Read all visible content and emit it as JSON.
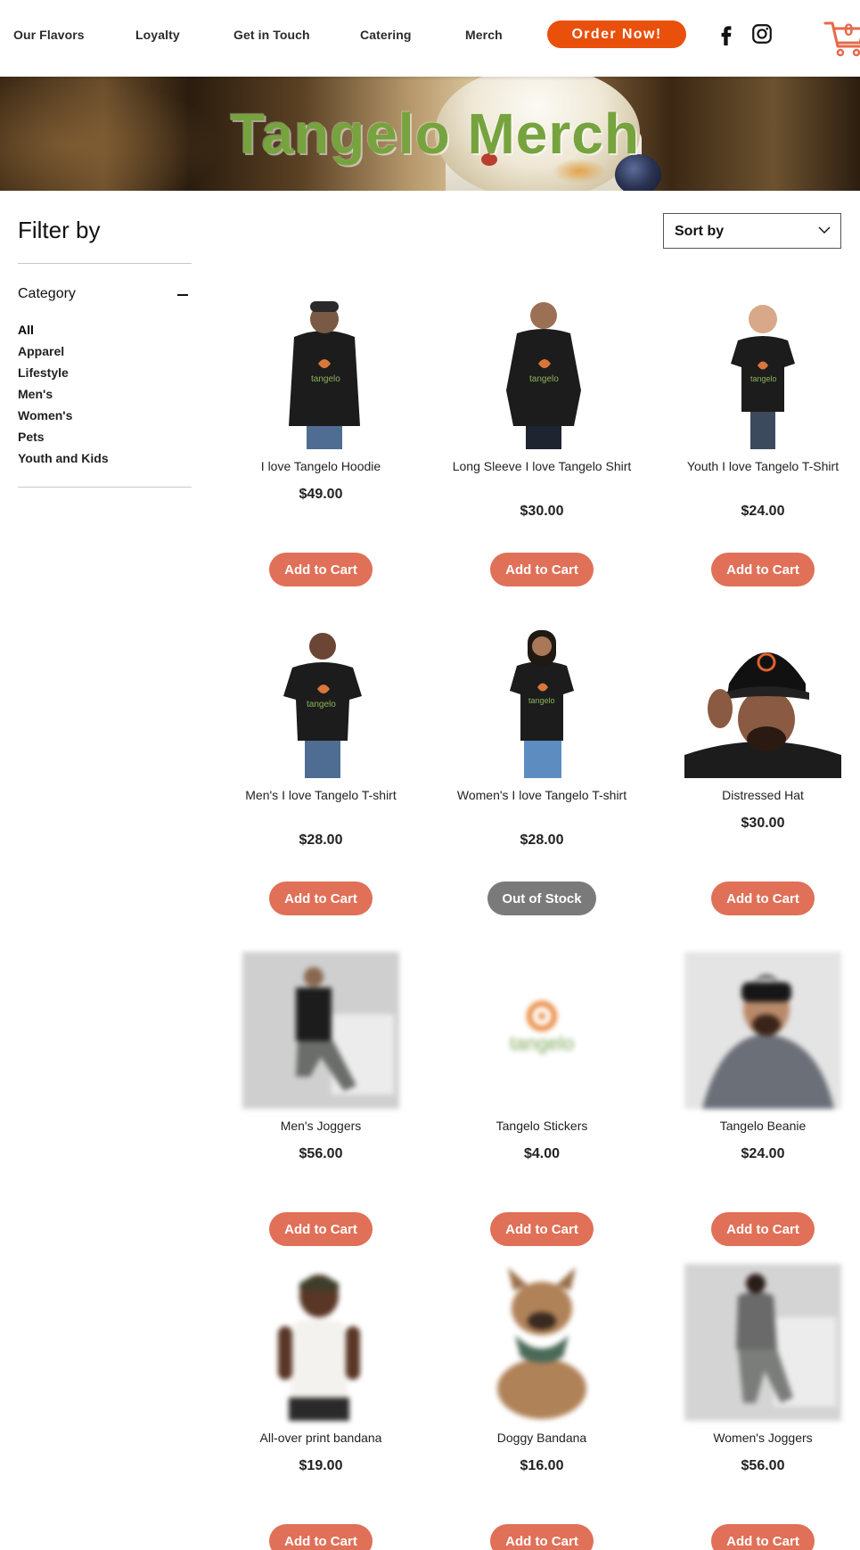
{
  "header": {
    "nav": [
      {
        "label": "Our Flavors"
      },
      {
        "label": "Loyalty"
      },
      {
        "label": "Get in Touch"
      },
      {
        "label": "Catering"
      },
      {
        "label": "Merch"
      }
    ],
    "order_button": "Order Now!",
    "social": [
      "facebook-icon",
      "instagram-icon"
    ],
    "cart_count": "0"
  },
  "banner": {
    "title": "Tangelo Merch"
  },
  "filter": {
    "title": "Filter by",
    "category_title": "Category",
    "categories": [
      "All",
      "Apparel",
      "Lifestyle",
      "Men's",
      "Women's",
      "Pets",
      "Youth and Kids"
    ]
  },
  "sort": {
    "label": "Sort by"
  },
  "colors": {
    "accent": "#e8500c",
    "button": "#e07058",
    "title_green": "#76a33e",
    "out_of_stock": "#7a7a7a"
  },
  "products": [
    {
      "name": "I love Tangelo Hoodie",
      "price": "$49.00",
      "button": "Add to Cart"
    },
    {
      "name": "Long Sleeve I love Tangelo Shirt",
      "price": "$30.00",
      "button": "Add to Cart"
    },
    {
      "name": "Youth I love Tangelo T-Shirt",
      "price": "$24.00",
      "button": "Add to Cart"
    },
    {
      "name": "Men's I love Tangelo T-shirt",
      "price": "$28.00",
      "button": "Add to Cart"
    },
    {
      "name": "Women's I love Tangelo T-shirt",
      "price": "$28.00",
      "button": "Out of Stock"
    },
    {
      "name": "Distressed Hat",
      "price": "$30.00",
      "button": "Add to Cart"
    },
    {
      "name": "Men's Joggers",
      "price": "$56.00",
      "button": "Add to Cart"
    },
    {
      "name": "Tangelo Stickers",
      "price": "$4.00",
      "button": "Add to Cart"
    },
    {
      "name": "Tangelo Beanie",
      "price": "$24.00",
      "button": "Add to Cart"
    },
    {
      "name": "All-over print bandana",
      "price": "$19.00",
      "button": "Add to Cart"
    },
    {
      "name": "Doggy Bandana",
      "price": "$16.00",
      "button": "Add to Cart"
    },
    {
      "name": "Women's Joggers",
      "price": "$56.00",
      "button": "Add to Cart"
    }
  ],
  "logo_text": "tangelo"
}
